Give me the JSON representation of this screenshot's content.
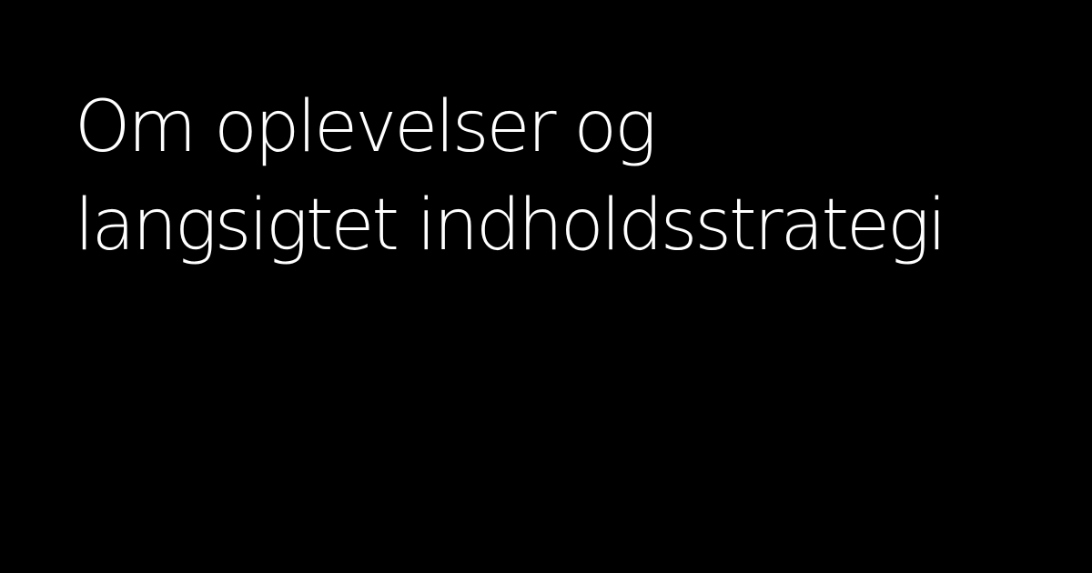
{
  "card": {
    "background_color": "#000000",
    "text_color": "#ffffff",
    "headline_lines": [
      "Om oplevelser og",
      "langsigtet indholdsstrategi"
    ]
  }
}
